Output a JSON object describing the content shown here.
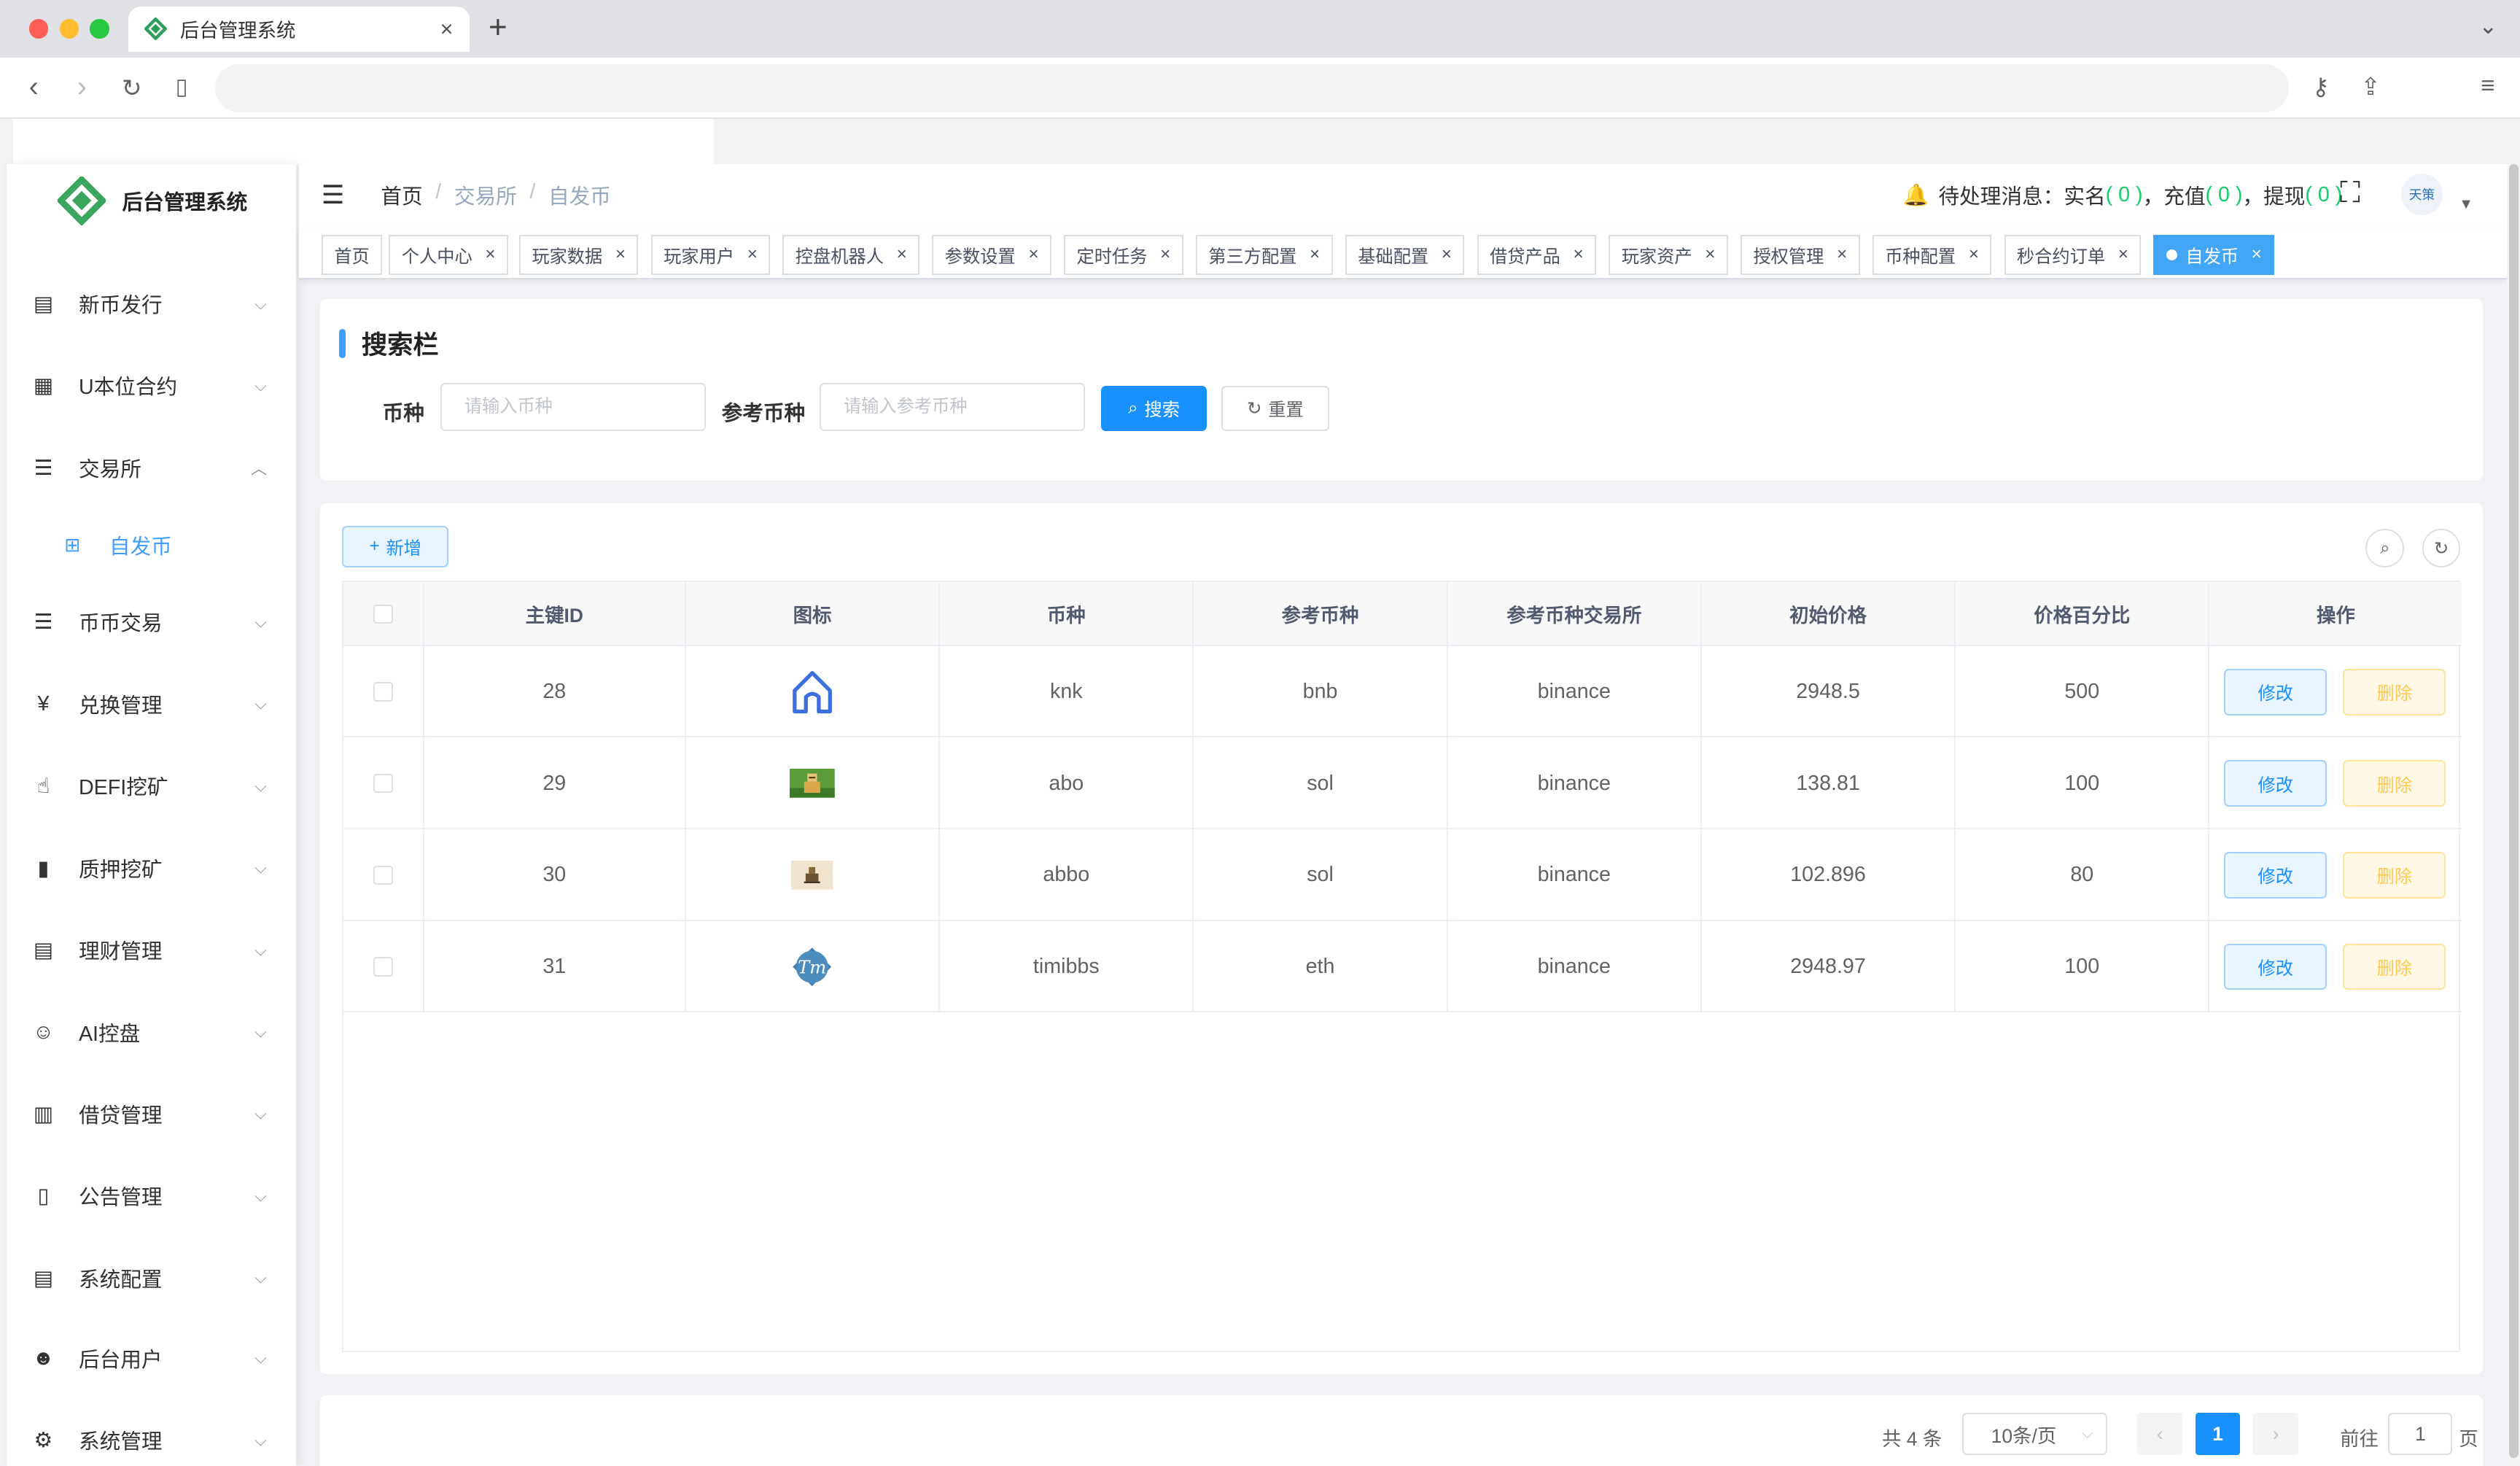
{
  "browser": {
    "tab_title": "后台管理系统",
    "tab_close": "×",
    "new_tab": "+"
  },
  "app": {
    "name": "后台管理系统"
  },
  "sidebar": {
    "items": [
      {
        "label": "新币发行",
        "icon": "newspaper-icon"
      },
      {
        "label": "U本位合约",
        "icon": "table-grid-icon"
      },
      {
        "label": "交易所",
        "icon": "list-tree-icon",
        "expanded": true
      },
      {
        "label": "币币交易",
        "icon": "list-icon"
      },
      {
        "label": "兑换管理",
        "icon": "yen-icon"
      },
      {
        "label": "DEFI挖矿",
        "icon": "hand-icon"
      },
      {
        "label": "质押挖矿",
        "icon": "bar-chart-icon"
      },
      {
        "label": "理财管理",
        "icon": "document-icon"
      },
      {
        "label": "AI控盘",
        "icon": "robot-icon"
      },
      {
        "label": "借贷管理",
        "icon": "book-icon"
      },
      {
        "label": "公告管理",
        "icon": "open-book-icon"
      },
      {
        "label": "系统配置",
        "icon": "document-icon"
      },
      {
        "label": "后台用户",
        "icon": "users-icon"
      },
      {
        "label": "系统管理",
        "icon": "gear-icon"
      }
    ],
    "submenu": {
      "label": "自发币",
      "icon": "table-icon"
    }
  },
  "header": {
    "breadcrumb": [
      "首页",
      "交易所",
      "自发币"
    ],
    "pending_label": "待处理消息：",
    "realname_label": "实名",
    "realname_count": "( 0 )",
    "recharge_label": "充值",
    "recharge_count": "( 0 )",
    "withdraw_label": "提现",
    "withdraw_count": "( 0 )",
    "comma": "，",
    "avatar_text": "天策"
  },
  "tags": [
    {
      "label": "首页",
      "closable": false
    },
    {
      "label": "个人中心",
      "closable": true
    },
    {
      "label": "玩家数据",
      "closable": true
    },
    {
      "label": "玩家用户",
      "closable": true
    },
    {
      "label": "控盘机器人",
      "closable": true
    },
    {
      "label": "参数设置",
      "closable": true
    },
    {
      "label": "定时任务",
      "closable": true
    },
    {
      "label": "第三方配置",
      "closable": true
    },
    {
      "label": "基础配置",
      "closable": true
    },
    {
      "label": "借贷产品",
      "closable": true
    },
    {
      "label": "玩家资产",
      "closable": true
    },
    {
      "label": "授权管理",
      "closable": true
    },
    {
      "label": "币种配置",
      "closable": true
    },
    {
      "label": "秒合约订单",
      "closable": true
    },
    {
      "label": "自发币",
      "closable": true,
      "active": true
    }
  ],
  "search": {
    "title": "搜索栏",
    "coin_label": "币种",
    "coin_placeholder": "请输入币种",
    "ref_label": "参考币种",
    "ref_placeholder": "请输入参考币种",
    "search_btn": "搜索",
    "reset_btn": "重置"
  },
  "toolbar": {
    "add_btn": "新增"
  },
  "table": {
    "columns": [
      "主键ID",
      "图标",
      "币种",
      "参考币种",
      "参考币种交易所",
      "初始价格",
      "价格百分比",
      "操作"
    ],
    "edit_label": "修改",
    "delete_label": "删除",
    "rows": [
      {
        "id": "28",
        "icon": "house-outline-icon",
        "coin": "knk",
        "ref": "bnb",
        "exchange": "binance",
        "price": "2948.5",
        "percent": "500"
      },
      {
        "id": "29",
        "icon": "pixel-figure-green-icon",
        "coin": "abo",
        "ref": "sol",
        "exchange": "binance",
        "price": "138.81",
        "percent": "100"
      },
      {
        "id": "30",
        "icon": "pixel-figure-beige-icon",
        "coin": "abbo",
        "ref": "sol",
        "exchange": "binance",
        "price": "102.896",
        "percent": "80"
      },
      {
        "id": "31",
        "icon": "tm-badge-icon",
        "coin": "timibbs",
        "ref": "eth",
        "exchange": "binance",
        "price": "2948.97",
        "percent": "100"
      }
    ]
  },
  "pagination": {
    "total_text": "共 4 条",
    "page_size": "10条/页",
    "current_page": "1",
    "goto_label": "前往",
    "goto_value": "1",
    "page_suffix": "页"
  },
  "colors": {
    "primary": "#1890ff",
    "active_tag": "#42a5f5",
    "success": "#13ce66",
    "danger_text": "#ffc851"
  }
}
